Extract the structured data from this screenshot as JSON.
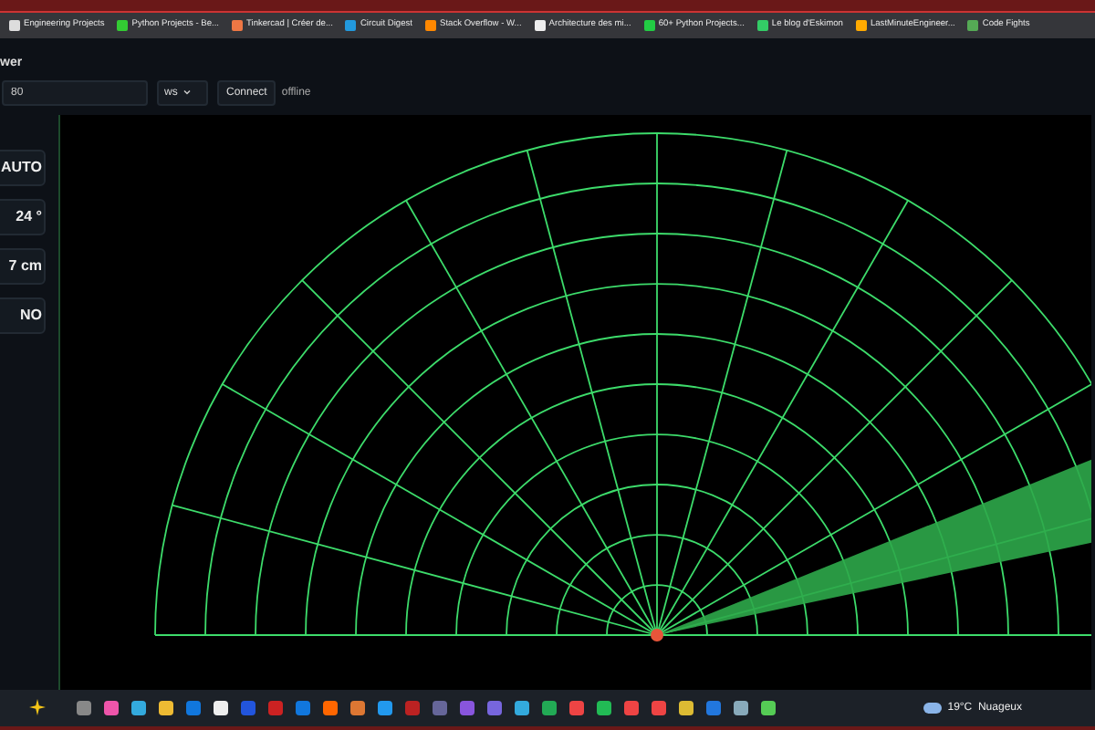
{
  "bookmarks": [
    "Engineering Projects",
    "Python Projects - Be...",
    "Tinkercad | Créer de...",
    "Circuit Digest",
    "Stack Overflow - W...",
    "Architecture des mi...",
    "60+ Python Projects...",
    "Le blog d'Eskimon",
    "LastMinuteEngineer...",
    "Code Fights"
  ],
  "header": {
    "title": "wer"
  },
  "connection": {
    "port": "80",
    "protocol": "ws",
    "button": "Connect",
    "status": "offline"
  },
  "readouts": [
    "AUTO",
    "24 °",
    "7 cm",
    "NO"
  ],
  "taskbar": {
    "weather": "19°C  Nuageux"
  }
}
